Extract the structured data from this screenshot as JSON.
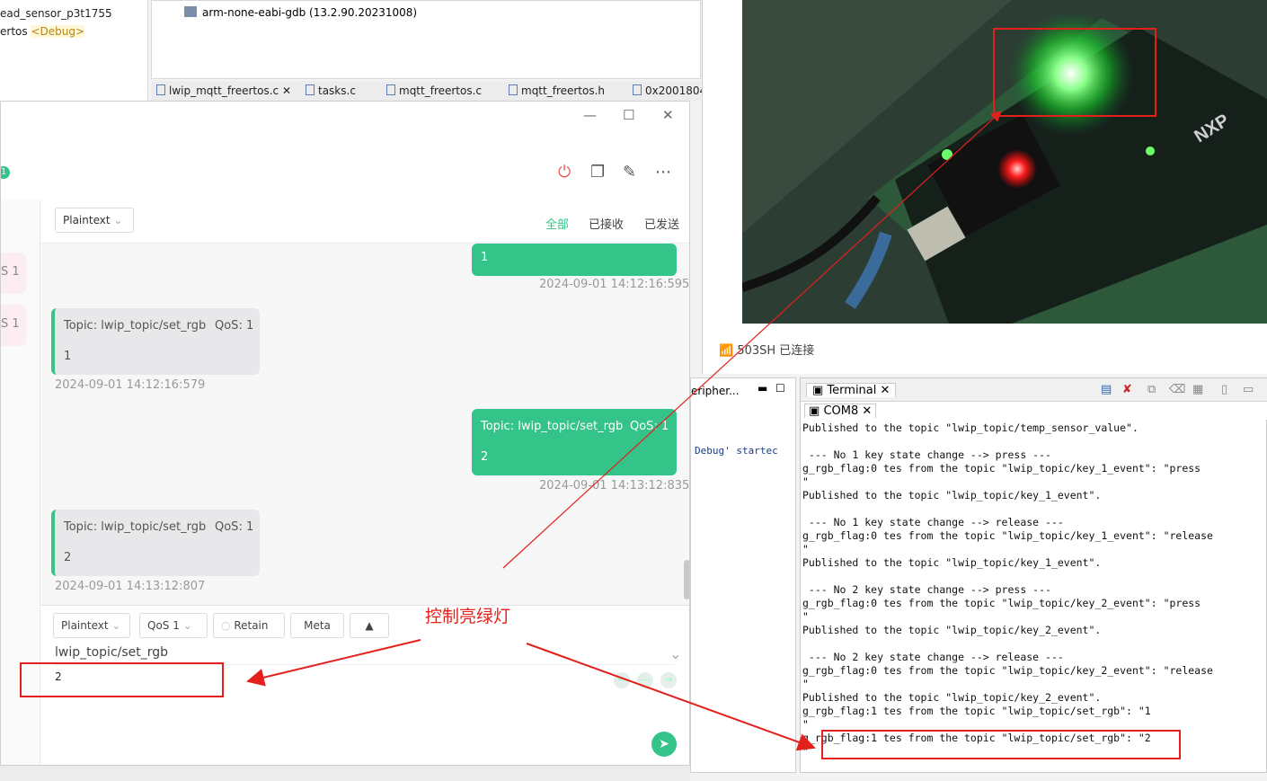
{
  "ide": {
    "project_lines": [
      "ead_sensor_p3t1755",
      "ertos",
      "<Debug>"
    ],
    "outline_item": "arm-none-eabi-gdb (13.2.90.20231008)",
    "editor_tabs": [
      "lwip_mqtt_freertos.c",
      "tasks.c",
      "mqtt_freertos.c",
      "mqtt_freertos.h",
      "0x2001804"
    ],
    "bottom_left_tab": "eripher...",
    "bottom_left_text": "Debug' startec"
  },
  "mqttx": {
    "conn_badge": "1",
    "sidebar_badges": [
      "S 1",
      "S 1"
    ],
    "payload_format": "Plaintext",
    "filters": [
      "全部",
      "已接收",
      "已发送"
    ],
    "messages": [
      {
        "dir": "out",
        "topic": "",
        "qos": "",
        "payload": "1",
        "time": "2024-09-01 14:12:16:595"
      },
      {
        "dir": "in",
        "topic": "Topic: lwip_topic/set_rgb",
        "qos": "QoS: 1",
        "payload": "1",
        "time": "2024-09-01 14:12:16:579"
      },
      {
        "dir": "out",
        "topic": "Topic: lwip_topic/set_rgb",
        "qos": "QoS: 1",
        "payload": "2",
        "time": "2024-09-01 14:13:12:835"
      },
      {
        "dir": "in",
        "topic": "Topic: lwip_topic/set_rgb",
        "qos": "QoS: 1",
        "payload": "2",
        "time": "2024-09-01 14:13:12:807"
      }
    ],
    "composer": {
      "format": "Plaintext",
      "qos": "QoS 1",
      "retain": "Retain",
      "meta": "Meta",
      "topic": "lwip_topic/set_rgb",
      "payload": "2"
    }
  },
  "camera": {
    "wifi_status": "503SH 已连接",
    "board_brand": "NXP"
  },
  "terminal": {
    "tab": "Terminal",
    "port": "COM8",
    "lines": [
      "Published to the topic \"lwip_topic/temp_sensor_value\".",
      "",
      " --- No 1 key state change --> press ---",
      "g_rgb_flag:0 tes from the topic \"lwip_topic/key_1_event\": \"press",
      "\"",
      "Published to the topic \"lwip_topic/key_1_event\".",
      "",
      " --- No 1 key state change --> release ---",
      "g_rgb_flag:0 tes from the topic \"lwip_topic/key_1_event\": \"release",
      "\"",
      "Published to the topic \"lwip_topic/key_1_event\".",
      "",
      " --- No 2 key state change --> press ---",
      "g_rgb_flag:0 tes from the topic \"lwip_topic/key_2_event\": \"press",
      "\"",
      "Published to the topic \"lwip_topic/key_2_event\".",
      "",
      " --- No 2 key state change --> release ---",
      "g_rgb_flag:0 tes from the topic \"lwip_topic/key_2_event\": \"release",
      "\"",
      "Published to the topic \"lwip_topic/key_2_event\".",
      "g_rgb_flag:1 tes from the topic \"lwip_topic/set_rgb\": \"1",
      "\"",
      "g_rgb_flag:1 tes from the topic \"lwip_topic/set_rgb\": \"2",
      "\""
    ]
  },
  "annotation": {
    "label": "控制亮绿灯",
    "color": "#e3201b"
  },
  "colors": {
    "accent_green": "#34c388",
    "annotation_red": "#e3201b"
  }
}
